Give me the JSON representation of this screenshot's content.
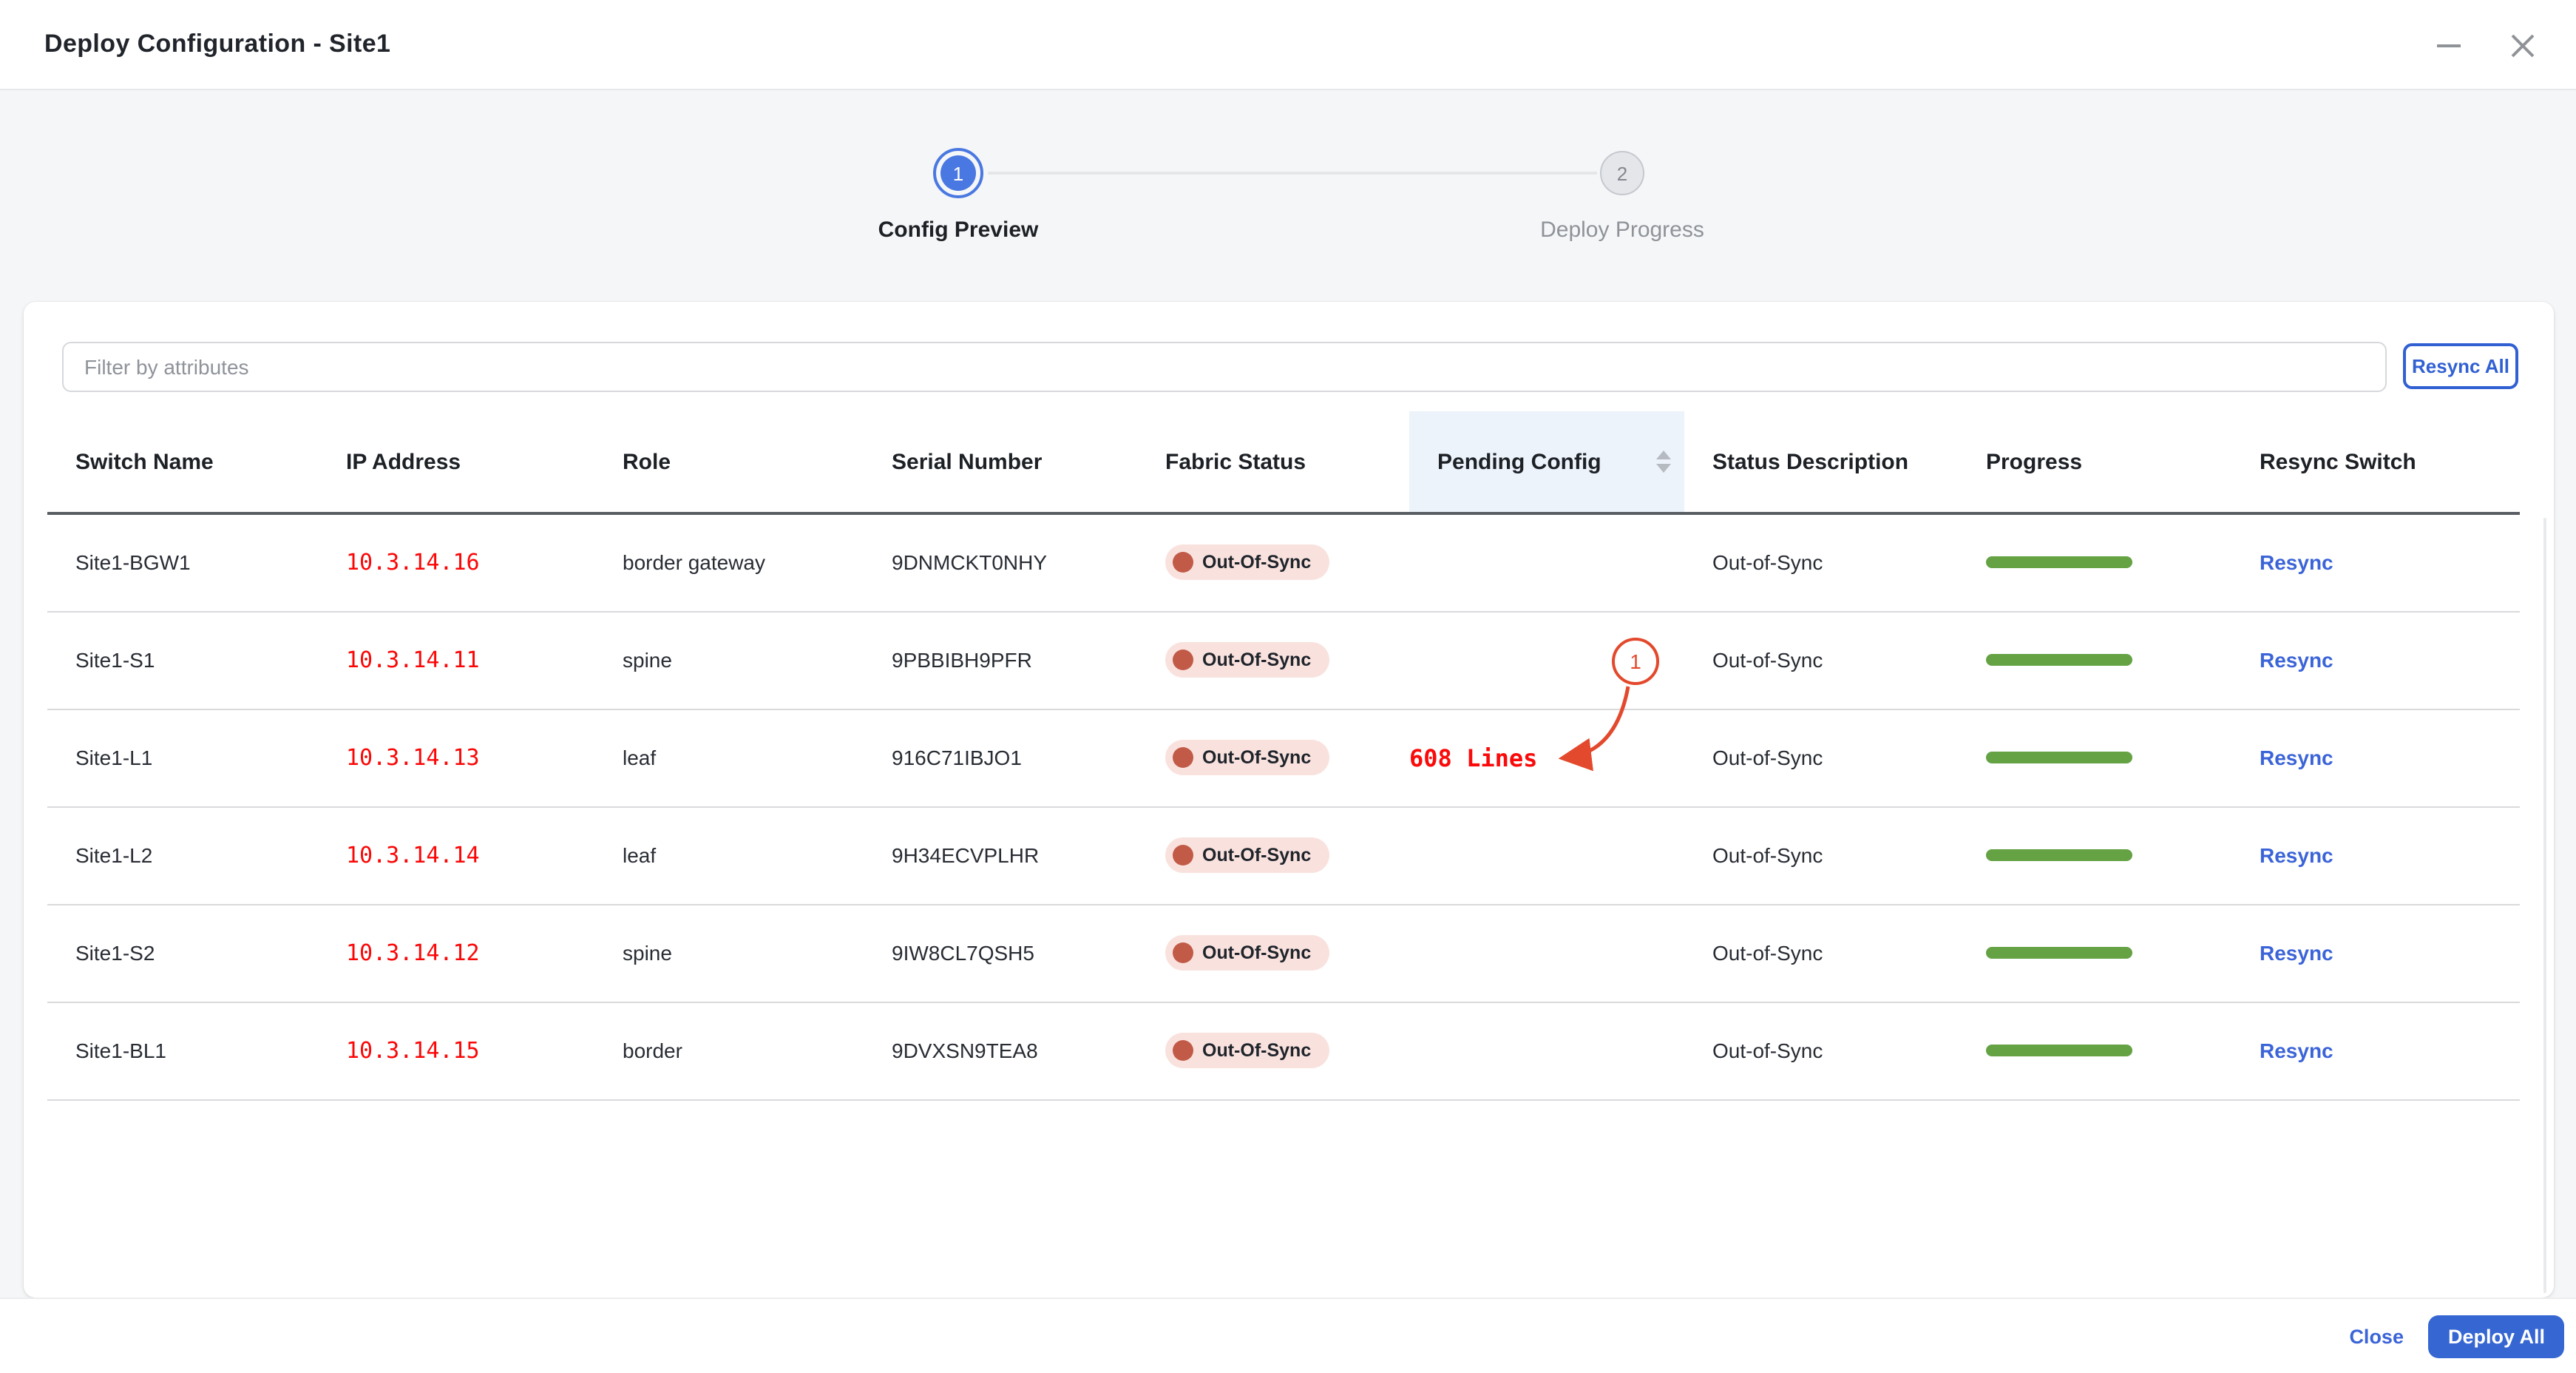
{
  "window": {
    "title": "Deploy Configuration - Site1"
  },
  "stepper": {
    "steps": [
      {
        "number": "1",
        "label": "Config Preview",
        "state": "active"
      },
      {
        "number": "2",
        "label": "Deploy Progress",
        "state": "upcoming"
      }
    ]
  },
  "toolbar": {
    "filter_placeholder": "Filter by attributes",
    "resync_all_label": "Resync All"
  },
  "table": {
    "columns": [
      {
        "label": "Switch Name"
      },
      {
        "label": "IP Address"
      },
      {
        "label": "Role"
      },
      {
        "label": "Serial Number"
      },
      {
        "label": "Fabric Status"
      },
      {
        "label": "Pending Config",
        "sorted": true
      },
      {
        "label": "Status Description"
      },
      {
        "label": "Progress"
      },
      {
        "label": "Resync Switch"
      }
    ],
    "rows": [
      {
        "switch_name": "Site1-BGW1",
        "ip": "10.3.14.16",
        "role": "border gateway",
        "serial": "9DNMCKT0NHY",
        "fabric_status": "Out-Of-Sync",
        "pending_config": "",
        "status_description": "Out-of-Sync",
        "progress_percent": 100,
        "resync_label": "Resync"
      },
      {
        "switch_name": "Site1-S1",
        "ip": "10.3.14.11",
        "role": "spine",
        "serial": "9PBBIBH9PFR",
        "fabric_status": "Out-Of-Sync",
        "pending_config": "",
        "status_description": "Out-of-Sync",
        "progress_percent": 100,
        "resync_label": "Resync"
      },
      {
        "switch_name": "Site1-L1",
        "ip": "10.3.14.13",
        "role": "leaf",
        "serial": "916C71IBJO1",
        "fabric_status": "Out-Of-Sync",
        "pending_config": "608 Lines",
        "status_description": "Out-of-Sync",
        "progress_percent": 100,
        "resync_label": "Resync"
      },
      {
        "switch_name": "Site1-L2",
        "ip": "10.3.14.14",
        "role": "leaf",
        "serial": "9H34ECVPLHR",
        "fabric_status": "Out-Of-Sync",
        "pending_config": "",
        "status_description": "Out-of-Sync",
        "progress_percent": 100,
        "resync_label": "Resync"
      },
      {
        "switch_name": "Site1-S2",
        "ip": "10.3.14.12",
        "role": "spine",
        "serial": "9IW8CL7QSH5",
        "fabric_status": "Out-Of-Sync",
        "pending_config": "",
        "status_description": "Out-of-Sync",
        "progress_percent": 100,
        "resync_label": "Resync"
      },
      {
        "switch_name": "Site1-BL1",
        "ip": "10.3.14.15",
        "role": "border",
        "serial": "9DVXSN9TEA8",
        "fabric_status": "Out-Of-Sync",
        "pending_config": "",
        "status_description": "Out-of-Sync",
        "progress_percent": 100,
        "resync_label": "Resync"
      }
    ]
  },
  "annotation": {
    "badge_number": "1",
    "points_to_text": "608 Lines"
  },
  "footer": {
    "close_label": "Close",
    "deploy_all_label": "Deploy All"
  },
  "colors": {
    "accent_blue": "#3566d2",
    "step_active_blue": "#4a78e2",
    "link_blue": "#3b64d8",
    "ip_red": "#fb0707",
    "note_red": "#fa0a0a",
    "annotation_red": "#e3492c",
    "progress_green": "#64a244",
    "badge_bg": "#f9e2de",
    "badge_dot": "#c25a48",
    "sorted_header_bg": "#ecf3fb"
  }
}
